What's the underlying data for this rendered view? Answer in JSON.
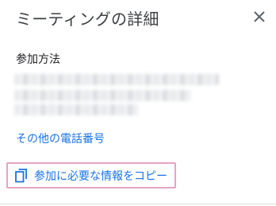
{
  "dialog": {
    "title": "ミーティングの詳細",
    "close_icon": "close-icon"
  },
  "join_info": {
    "heading": "参加方法",
    "other_numbers_link": "その他の電話番号",
    "copy_button_label": "参加に必要な情報をコピー",
    "copy_icon": "copy-icon"
  },
  "colors": {
    "link": "#1a73e8",
    "title_text": "#3c4043",
    "highlight_border": "#e6a3c4"
  }
}
